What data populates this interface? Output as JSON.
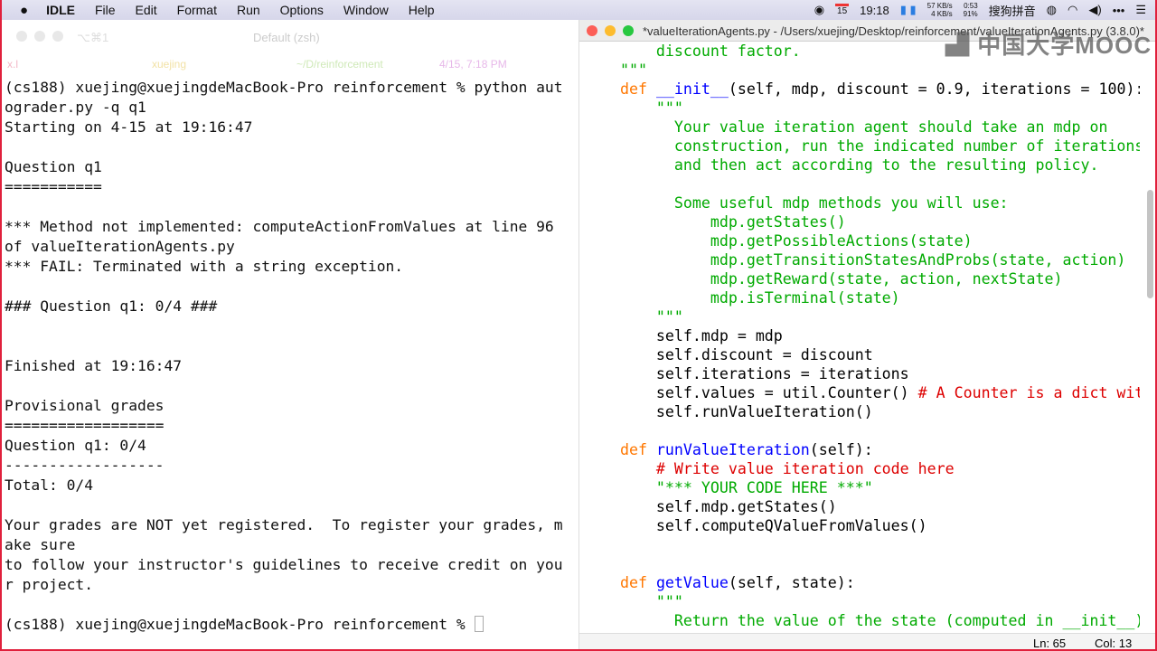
{
  "menubar": {
    "apple": "",
    "app": "IDLE",
    "items": [
      "File",
      "Edit",
      "Format",
      "Run",
      "Options",
      "Window",
      "Help"
    ],
    "tray": {
      "date_badge": "15",
      "time": "19:18",
      "net_up": "57 KB/s",
      "net_down": "4 KB/s",
      "battery_time": "0:53",
      "battery_pct": "91%",
      "ime": "搜狗拼音"
    }
  },
  "terminal": {
    "title": "Default (zsh)",
    "shortcut": "⌥⌘1",
    "info": {
      "session": "x.l",
      "user": "xuejing",
      "dir": "~/D/reinforcement",
      "time": "4/15, 7:18 PM"
    },
    "lines": [
      "(cs188) xuejing@xuejingdeMacBook-Pro reinforcement % python aut",
      "ograder.py -q q1",
      "Starting on 4-15 at 19:16:47",
      "",
      "Question q1",
      "===========",
      "",
      "*** Method not implemented: computeActionFromValues at line 96",
      "of valueIterationAgents.py",
      "*** FAIL: Terminated with a string exception.",
      "",
      "### Question q1: 0/4 ###",
      "",
      "",
      "Finished at 19:16:47",
      "",
      "Provisional grades",
      "==================",
      "Question q1: 0/4",
      "------------------",
      "Total: 0/4",
      "",
      "Your grades are NOT yet registered.  To register your grades, m",
      "ake sure",
      "to follow your instructor's guidelines to receive credit on you",
      "r project.",
      "",
      "(cs188) xuejing@xuejingdeMacBook-Pro reinforcement % "
    ]
  },
  "editor": {
    "title": "*valueIterationAgents.py - /Users/xuejing/Desktop/reinforcement/valueIterationAgents.py (3.8.0)*",
    "watermark": "中国大学MOOC",
    "colors": {
      "keyword": "#ff7700",
      "def": "#0000ff",
      "string": "#00aa00",
      "comment": "#dd0000"
    },
    "code": [
      [
        [
          "str",
          "        discount factor."
        ]
      ],
      [
        [
          "str",
          "    \"\"\""
        ]
      ],
      [
        [
          "kw",
          "    def "
        ],
        [
          "fn",
          "__init__"
        ],
        [
          "",
          "(self, mdp, discount = 0.9, iterations = 100):"
        ]
      ],
      [
        [
          "str",
          "        \"\"\""
        ]
      ],
      [
        [
          "str",
          "          Your value iteration agent should take an mdp on"
        ]
      ],
      [
        [
          "str",
          "          construction, run the indicated number of iterations"
        ]
      ],
      [
        [
          "str",
          "          and then act according to the resulting policy."
        ]
      ],
      [
        [
          "str",
          ""
        ]
      ],
      [
        [
          "str",
          "          Some useful mdp methods you will use:"
        ]
      ],
      [
        [
          "str",
          "              mdp.getStates()"
        ]
      ],
      [
        [
          "str",
          "              mdp.getPossibleActions(state)"
        ]
      ],
      [
        [
          "str",
          "              mdp.getTransitionStatesAndProbs(state, action)"
        ]
      ],
      [
        [
          "str",
          "              mdp.getReward(state, action, nextState)"
        ]
      ],
      [
        [
          "str",
          "              mdp.isTerminal(state)"
        ]
      ],
      [
        [
          "str",
          "        \"\"\""
        ]
      ],
      [
        [
          "",
          "        self.mdp = mdp"
        ]
      ],
      [
        [
          "",
          "        self.discount = discount"
        ]
      ],
      [
        [
          "",
          "        self.iterations = iterations"
        ]
      ],
      [
        [
          "",
          "        self.values = util.Counter() "
        ],
        [
          "cm",
          "# A Counter is a dict wit"
        ]
      ],
      [
        [
          "",
          "        self.runValueIteration()"
        ]
      ],
      [
        [
          "",
          ""
        ]
      ],
      [
        [
          "kw",
          "    def "
        ],
        [
          "fn",
          "runValueIteration"
        ],
        [
          "",
          "(self):"
        ]
      ],
      [
        [
          "cm",
          "        # Write value iteration code here"
        ]
      ],
      [
        [
          "str",
          "        \"*** YOUR CODE HERE ***\""
        ]
      ],
      [
        [
          "",
          "        self.mdp.getStates()"
        ]
      ],
      [
        [
          "",
          "        self.computeQValueFromValues()"
        ]
      ],
      [
        [
          "",
          ""
        ]
      ],
      [
        [
          "",
          ""
        ]
      ],
      [
        [
          "kw",
          "    def "
        ],
        [
          "fn",
          "getValue"
        ],
        [
          "",
          "(self, state):"
        ]
      ],
      [
        [
          "str",
          "        \"\"\""
        ]
      ],
      [
        [
          "str",
          "          Return the value of the state (computed in __init__)."
        ]
      ]
    ],
    "status": {
      "ln": "Ln: 65",
      "col": "Col: 13"
    }
  }
}
